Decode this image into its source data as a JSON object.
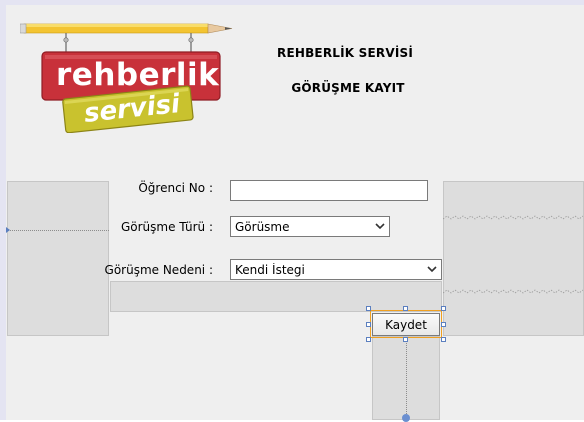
{
  "header": {
    "title": "REHBERLİK SERVİSİ",
    "subtitle": "GÖRÜŞME KAYIT"
  },
  "logo": {
    "line1": "rehberlik",
    "line2": "servisi"
  },
  "form": {
    "student_no_label": "Öğrenci No :",
    "student_no_value": "",
    "interview_type_label": "Görüşme Türü :",
    "interview_type_value": "Görüsme",
    "interview_reason_label": "Görüşme Nedeni :",
    "interview_reason_value": "Kendi İstegi"
  },
  "actions": {
    "save_label": "Kaydet"
  },
  "colors": {
    "logo_red": "#c8313a",
    "logo_yellow": "#c9c22e",
    "pencil_yellow": "#f3c431",
    "selection_orange": "#f0a020"
  },
  "icons": {
    "dropdown": "chevron-down-icon"
  }
}
